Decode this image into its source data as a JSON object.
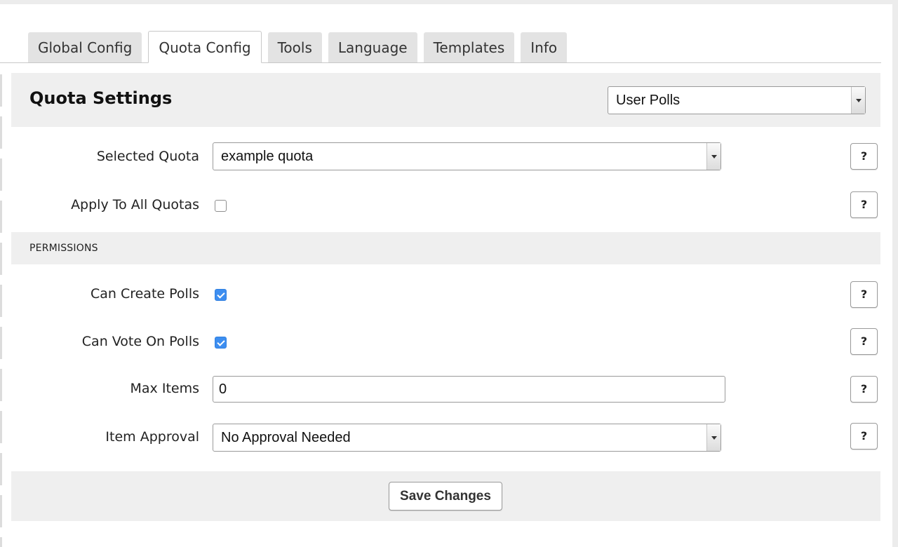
{
  "tabs": [
    {
      "label": "Global Config",
      "active": false
    },
    {
      "label": "Quota Config",
      "active": true
    },
    {
      "label": "Tools",
      "active": false
    },
    {
      "label": "Language",
      "active": false
    },
    {
      "label": "Templates",
      "active": false
    },
    {
      "label": "Info",
      "active": false
    }
  ],
  "header": {
    "title": "Quota Settings",
    "module_select": "User Polls"
  },
  "fields": {
    "selected_quota": {
      "label": "Selected Quota",
      "value": "example quota"
    },
    "apply_all": {
      "label": "Apply To All Quotas",
      "checked": false
    },
    "permissions_heading": "PERMISSIONS",
    "can_create": {
      "label": "Can Create Polls",
      "checked": true
    },
    "can_vote": {
      "label": "Can Vote On Polls",
      "checked": true
    },
    "max_items": {
      "label": "Max Items",
      "value": "0"
    },
    "item_approval": {
      "label": "Item Approval",
      "value": "No Approval Needed"
    }
  },
  "help_label": "?",
  "save_label": "Save Changes",
  "colors": {
    "accent_checkbox": "#3d8ef0",
    "section_bg": "#efefef",
    "tab_bg": "#e3e3e3"
  }
}
